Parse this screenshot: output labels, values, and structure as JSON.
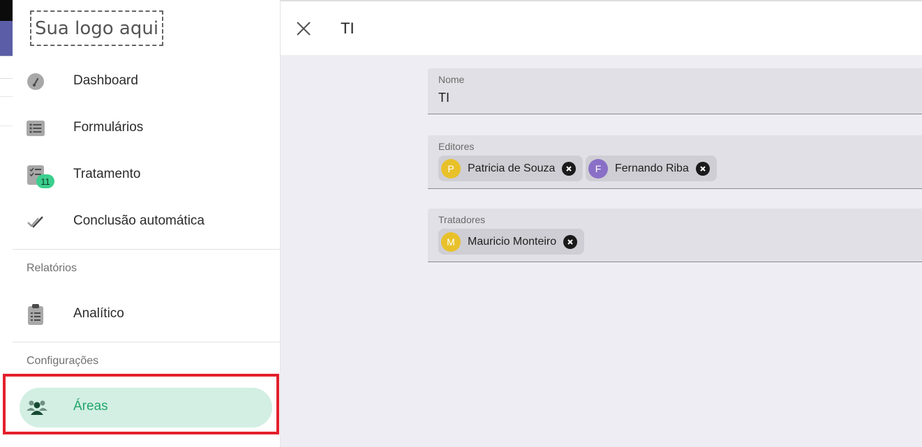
{
  "logo": {
    "text": "Sua logo aqui"
  },
  "nav": {
    "items": [
      {
        "label": "Dashboard",
        "icon": "gauge-icon"
      },
      {
        "label": "Formulários",
        "icon": "list-icon"
      },
      {
        "label": "Tratamento",
        "icon": "checklist-icon",
        "badge": "11"
      },
      {
        "label": "Conclusão automática",
        "icon": "double-check-icon"
      }
    ],
    "reports_title": "Relatórios",
    "reports_items": [
      {
        "label": "Analítico",
        "icon": "clipboard-icon"
      }
    ],
    "config_title": "Configurações",
    "config_items": [
      {
        "label": "Áreas",
        "icon": "people-icon",
        "active": true
      }
    ]
  },
  "panel": {
    "title": "TI",
    "fields": {
      "name": {
        "label": "Nome",
        "value": "TI"
      },
      "editors": {
        "label": "Editores",
        "chips": [
          {
            "initial": "P",
            "name": "Patricia de Souza",
            "color": "#e8c12a"
          },
          {
            "initial": "F",
            "name": "Fernando Riba",
            "color": "#8a6fc7"
          }
        ]
      },
      "handlers": {
        "label": "Tratadores",
        "chips": [
          {
            "initial": "M",
            "name": "Mauricio Monteiro",
            "color": "#e8c12a"
          }
        ]
      }
    }
  },
  "colors": {
    "accent": "#22a56a",
    "active_bg": "#d3efe4",
    "badge": "#3ccf8e",
    "highlight": "#e3202c"
  }
}
